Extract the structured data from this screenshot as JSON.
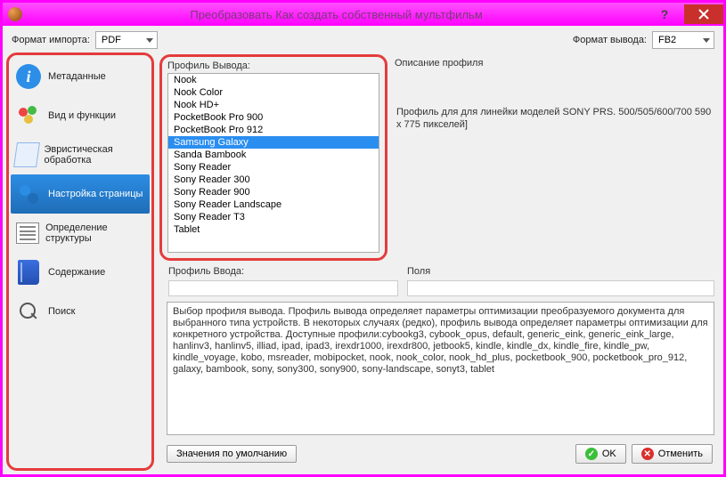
{
  "window": {
    "title": "Преобразовать Как создать собственный мультфильм"
  },
  "top": {
    "import_label": "Формат импорта:",
    "import_value": "PDF",
    "output_label": "Формат вывода:",
    "output_value": "FB2"
  },
  "sidebar": {
    "items": [
      {
        "label": "Метаданные"
      },
      {
        "label": "Вид и функции"
      },
      {
        "label": "Эвристическая обработка"
      },
      {
        "label": "Настройка страницы"
      },
      {
        "label": "Определение структуры"
      },
      {
        "label": "Содержание"
      },
      {
        "label": "Поиск"
      }
    ],
    "active_index": 3
  },
  "profile": {
    "output_label": "Профиль Вывода:",
    "input_label": "Профиль Ввода:",
    "options": [
      "Nook",
      "Nook Color",
      "Nook HD+",
      "PocketBook Pro 900",
      "PocketBook Pro 912",
      "Samsung Galaxy",
      "Sanda Bambook",
      "Sony Reader",
      "Sony Reader 300",
      "Sony Reader 900",
      "Sony Reader Landscape",
      "Sony Reader T3",
      "Tablet"
    ],
    "selected_index": 5
  },
  "description": {
    "label": "Описание профиля",
    "text": "Профиль для для линейки моделей SONY PRS. 500/505/600/700 590 x 775 пикселей]"
  },
  "fields": {
    "label": "Поля"
  },
  "help_text": "Выбор профиля вывода. Профиль вывода определяет параметры оптимизации преобразуемого документа для выбранного типа устройств. В некоторых случаях (редко), профиль вывода определяет параметры оптимизации для конкретного устройства. Доступные профили:cybookg3, cybook_opus, default, generic_eink, generic_eink_large, hanlinv3, hanlinv5, illiad, ipad, ipad3, irexdr1000, irexdr800, jetbook5, kindle, kindle_dx, kindle_fire, kindle_pw, kindle_voyage, kobo, msreader, mobipocket, nook, nook_color, nook_hd_plus, pocketbook_900, pocketbook_pro_912, galaxy, bambook, sony, sony300, sony900, sony-landscape, sonyt3, tablet",
  "buttons": {
    "defaults": "Значения по умолчанию",
    "ok": "OK",
    "cancel": "Отменить"
  }
}
